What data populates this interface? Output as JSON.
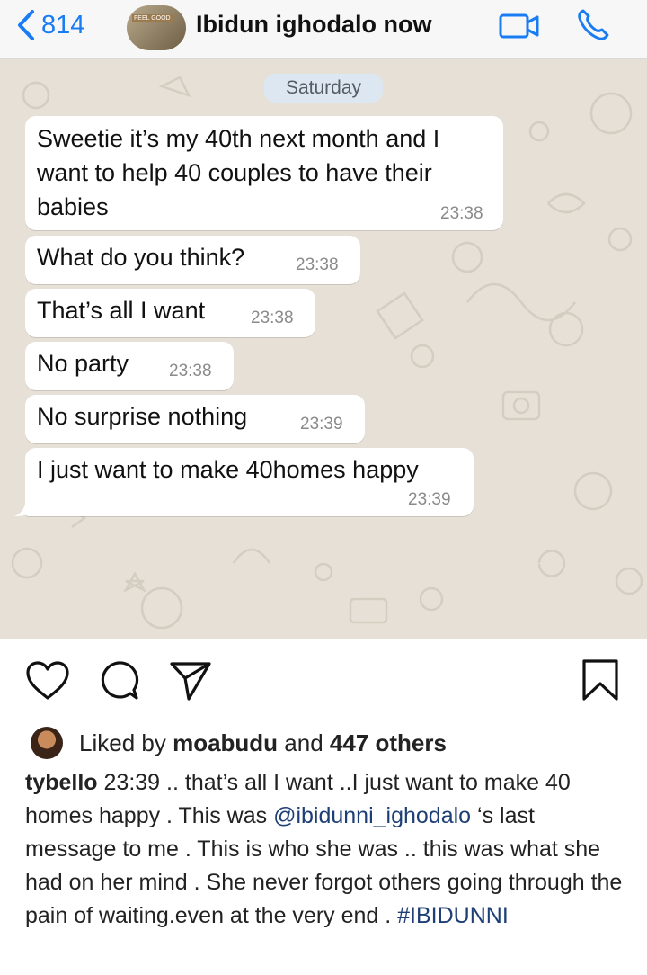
{
  "header": {
    "back_count": "814",
    "contact_name": "Ibidun ighodalo now",
    "avatar_tag": "FEEL GOOD",
    "accent": "#1a7cf3"
  },
  "chat": {
    "date_label": "Saturday",
    "messages": [
      {
        "text_lines": [
          "Sweetie it’s my 40th next month and I",
          "want to help 40 couples to have their",
          "babies"
        ],
        "time": "23:38"
      },
      {
        "text_lines": [
          "What do you think?"
        ],
        "time": "23:38"
      },
      {
        "text_lines": [
          "That’s all I want"
        ],
        "time": "23:38"
      },
      {
        "text_lines": [
          "No party"
        ],
        "time": "23:38"
      },
      {
        "text_lines": [
          "No surprise nothing"
        ],
        "time": "23:39"
      },
      {
        "text_lines": [
          "I just want to make 40homes happy"
        ],
        "time": "23:39"
      }
    ]
  },
  "post": {
    "liked_prefix": "Liked by ",
    "liked_user": "moabudu",
    "liked_and": " and ",
    "liked_count": "447 others",
    "caption_user": "tybello",
    "caption_part1": " 23:39 .. that’s all I want ..I just want to make 40 homes happy . This was ",
    "caption_mention": "@ibidunni_ighodalo",
    "caption_part2": " ‘s last message to me . This is who she was .. this was what she had on her mind . She  never forgot others going through the pain of waiting.even at the very end . ",
    "caption_hashtag": "#IBIDUNNI"
  },
  "icons": {
    "back": "chevron-left-icon",
    "video": "video-camera-icon",
    "phone": "phone-icon",
    "like": "heart-icon",
    "comment": "comment-bubble-icon",
    "share": "paper-plane-icon",
    "save": "bookmark-icon"
  }
}
